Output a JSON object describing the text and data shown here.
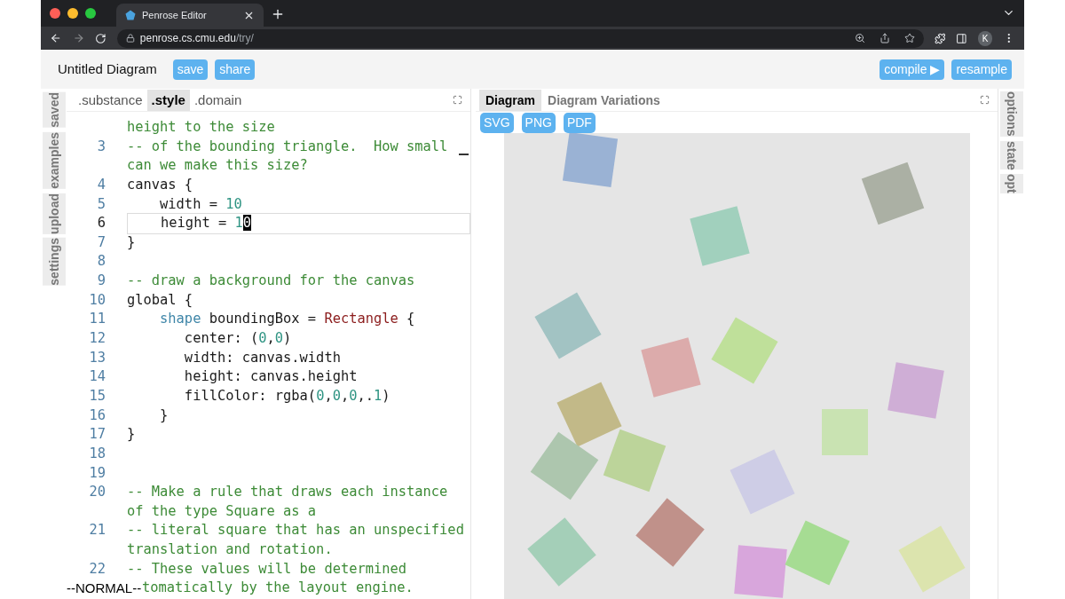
{
  "browser": {
    "tab_title": "Penrose Editor",
    "url_host": "penrose.cs.cmu.edu",
    "url_path": "/try/",
    "avatar": "K"
  },
  "header": {
    "title": "Untitled Diagram",
    "left_buttons": [
      "save",
      "share"
    ],
    "right_buttons": [
      "compile ▶",
      "resample"
    ]
  },
  "left_tabs": [
    "saved",
    "examples",
    "upload",
    "settings"
  ],
  "editor": {
    "tabs": [
      {
        "label": ".substance",
        "selected": false
      },
      {
        "label": ".style",
        "selected": true
      },
      {
        "label": ".domain",
        "selected": false
      }
    ],
    "lines": [
      {
        "active": false,
        "segments": [
          {
            "text": "height to the size",
            "kind": "comment"
          }
        ]
      },
      {
        "number": "3",
        "active": false,
        "segments": [
          {
            "text": "-- of the bounding triangle.  How small",
            "kind": "comment"
          }
        ]
      },
      {
        "active": false,
        "segments": [
          {
            "text": "can we make this size?",
            "kind": "comment"
          }
        ]
      },
      {
        "number": "4",
        "active": false,
        "segments": [
          {
            "text": "canvas {",
            "kind": "plain"
          }
        ]
      },
      {
        "number": "5",
        "active": false,
        "segments": [
          {
            "text": "    width = ",
            "kind": "plain"
          },
          {
            "text": "10",
            "kind": "number"
          }
        ]
      },
      {
        "number": "6",
        "active": true,
        "segments": [
          {
            "text": "    height = ",
            "kind": "plain"
          },
          {
            "text": "1",
            "kind": "number"
          },
          {
            "text": "0",
            "kind": "cursor"
          }
        ]
      },
      {
        "number": "7",
        "active": false,
        "segments": [
          {
            "text": "}",
            "kind": "plain"
          }
        ]
      },
      {
        "number": "8",
        "active": false
      },
      {
        "number": "9",
        "active": false,
        "segments": [
          {
            "text": "-- draw a background for the canvas",
            "kind": "comment"
          }
        ]
      },
      {
        "number": "10",
        "active": false,
        "segments": [
          {
            "text": "global {",
            "kind": "plain"
          }
        ]
      },
      {
        "number": "11",
        "active": false,
        "segments": [
          {
            "text": "    shape",
            "kind": "keyword"
          },
          {
            "text": " boundingBox = ",
            "kind": "plain"
          },
          {
            "text": "Rectangle",
            "kind": "type"
          },
          {
            "text": " {",
            "kind": "plain"
          }
        ]
      },
      {
        "number": "12",
        "active": false,
        "segments": [
          {
            "text": "       center: (",
            "kind": "plain"
          },
          {
            "text": "0",
            "kind": "number"
          },
          {
            "text": ",",
            "kind": "plain"
          },
          {
            "text": "0",
            "kind": "number"
          },
          {
            "text": ")",
            "kind": "plain"
          }
        ]
      },
      {
        "number": "13",
        "active": false,
        "segments": [
          {
            "text": "       width: canvas.width",
            "kind": "plain"
          }
        ]
      },
      {
        "number": "14",
        "active": false,
        "segments": [
          {
            "text": "       height: canvas.height",
            "kind": "plain"
          }
        ]
      },
      {
        "number": "15",
        "active": false,
        "segments": [
          {
            "text": "       fillColor: rgba(",
            "kind": "plain"
          },
          {
            "text": "0",
            "kind": "number"
          },
          {
            "text": ",",
            "kind": "plain"
          },
          {
            "text": "0",
            "kind": "number"
          },
          {
            "text": ",",
            "kind": "plain"
          },
          {
            "text": "0",
            "kind": "number"
          },
          {
            "text": ",.",
            "kind": "plain"
          },
          {
            "text": "1",
            "kind": "number"
          },
          {
            "text": ")",
            "kind": "plain"
          }
        ]
      },
      {
        "number": "16",
        "active": false,
        "segments": [
          {
            "text": "    }",
            "kind": "plain"
          }
        ]
      },
      {
        "number": "17",
        "active": false,
        "segments": [
          {
            "text": "}",
            "kind": "plain"
          }
        ]
      },
      {
        "number": "18",
        "active": false
      },
      {
        "number": "19",
        "active": false
      },
      {
        "number": "20",
        "active": false,
        "segments": [
          {
            "text": "-- Make a rule that draws each instance",
            "kind": "comment"
          }
        ]
      },
      {
        "active": false,
        "segments": [
          {
            "text": "of the type Square as a",
            "kind": "comment"
          }
        ]
      },
      {
        "number": "21",
        "active": false,
        "segments": [
          {
            "text": "-- literal square that has an unspecified",
            "kind": "comment"
          }
        ]
      },
      {
        "active": false,
        "segments": [
          {
            "text": "translation and rotation.",
            "kind": "comment"
          }
        ]
      },
      {
        "number": "22",
        "active": false,
        "segments": [
          {
            "text": "-- These values will be determined",
            "kind": "comment"
          }
        ]
      }
    ],
    "status_line": {
      "mode": "--NORMAL--",
      "text": "tomatically by the layout engine."
    }
  },
  "diagram": {
    "tabs": [
      {
        "label": "Diagram",
        "selected": true
      },
      {
        "label": "Diagram Variations",
        "selected": false
      }
    ],
    "exports": [
      "SVG",
      "PNG",
      "PDF"
    ]
  },
  "right_tabs": [
    "options",
    "state",
    "opt"
  ]
}
